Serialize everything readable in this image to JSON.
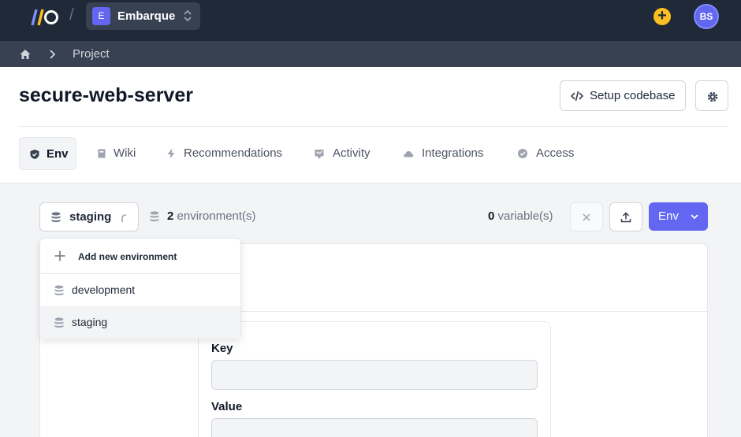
{
  "topbar": {
    "org_initial": "E",
    "org_name": "Embarque",
    "user_initials": "BS"
  },
  "breadcrumb": {
    "current": "Project"
  },
  "project": {
    "title": "secure-web-server",
    "setup_label": "Setup codebase"
  },
  "tabs": [
    {
      "label": "Env",
      "icon": "shield-icon",
      "active": true
    },
    {
      "label": "Wiki",
      "icon": "book-icon"
    },
    {
      "label": "Recommendations",
      "icon": "bolt-icon"
    },
    {
      "label": "Activity",
      "icon": "activity-icon"
    },
    {
      "label": "Integrations",
      "icon": "cloud-icon"
    },
    {
      "label": "Access",
      "icon": "check-circle-icon"
    }
  ],
  "toolbar": {
    "selected_env": "staging",
    "env_count": "2",
    "env_count_suffix": "environment(s)",
    "var_count": "0",
    "var_count_suffix": "variable(s)",
    "env_button_label": "Env"
  },
  "dropdown": {
    "add_label": "Add new environment",
    "items": [
      {
        "label": "development"
      },
      {
        "label": "staging",
        "selected": true
      }
    ]
  },
  "form": {
    "key_label": "Key",
    "value_label": "Value"
  },
  "colors": {
    "accent": "#6366f1",
    "topbar": "#1f2937",
    "plus": "#fbbf24"
  }
}
